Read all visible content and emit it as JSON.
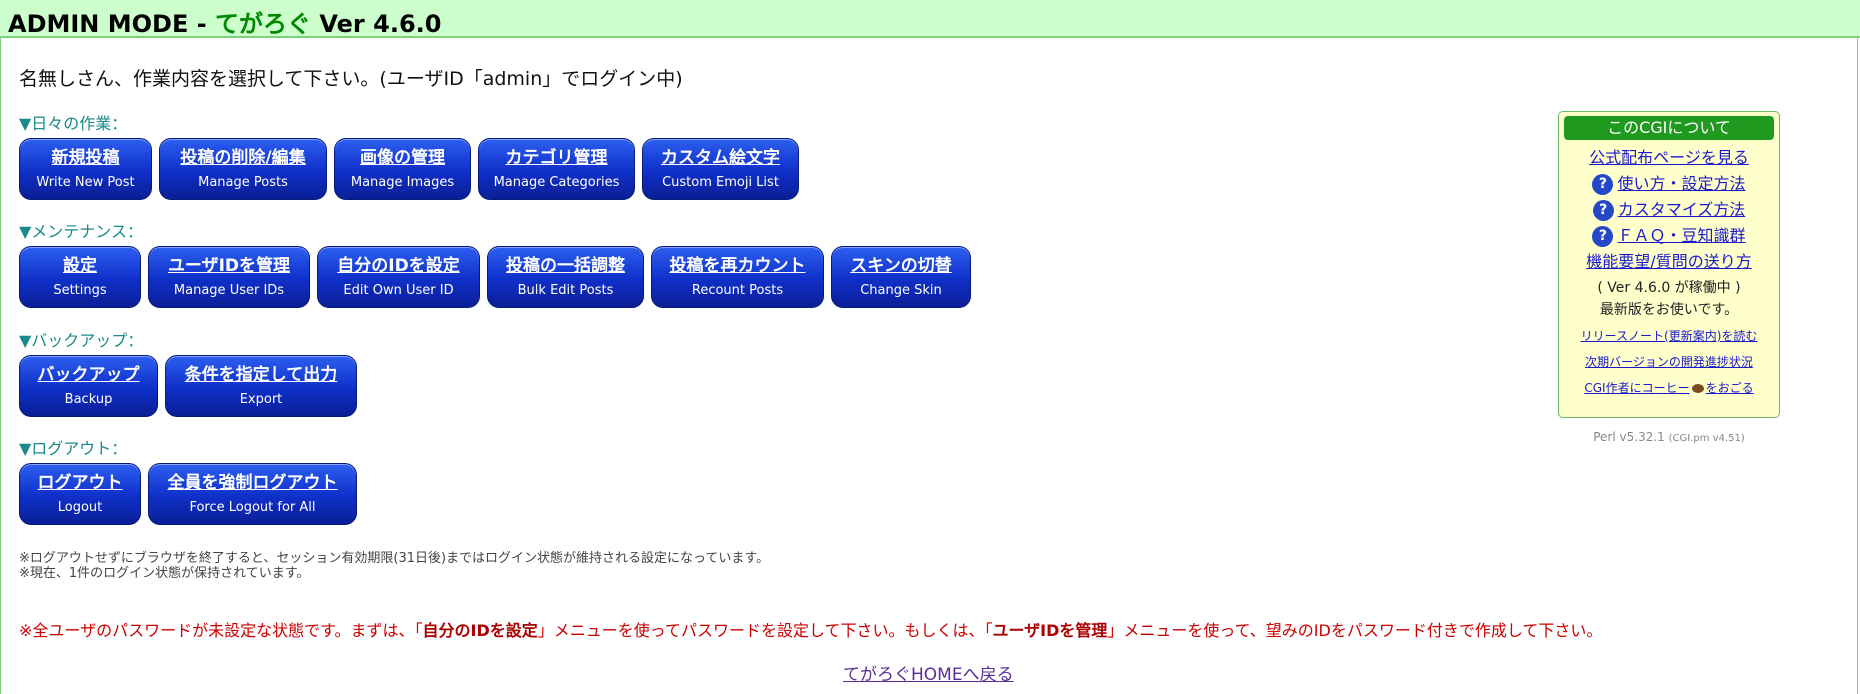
{
  "header": {
    "mode": "ADMIN MODE -",
    "app_name": "てがろぐ",
    "version": "Ver 4.6.0"
  },
  "welcome": "名無しさん、作業内容を選択して下さい。(ユーザID「admin」でログイン中)",
  "sections": [
    {
      "label": "▼日々の作業：",
      "buttons": [
        {
          "jp": "新規投稿",
          "en": "Write New Post"
        },
        {
          "jp": "投稿の削除/編集",
          "en": "Manage Posts"
        },
        {
          "jp": "画像の管理",
          "en": "Manage Images"
        },
        {
          "jp": "カテゴリ管理",
          "en": "Manage Categories"
        },
        {
          "jp": "カスタム絵文字",
          "en": "Custom Emoji List"
        }
      ]
    },
    {
      "label": "▼メンテナンス：",
      "buttons": [
        {
          "jp": "設定",
          "en": "Settings"
        },
        {
          "jp": "ユーザIDを管理",
          "en": "Manage User IDs"
        },
        {
          "jp": "自分のIDを設定",
          "en": "Edit Own User ID"
        },
        {
          "jp": "投稿の一括調整",
          "en": "Bulk Edit Posts"
        },
        {
          "jp": "投稿を再カウント",
          "en": "Recount Posts"
        },
        {
          "jp": "スキンの切替",
          "en": "Change Skin"
        }
      ]
    },
    {
      "label": "▼バックアップ：",
      "buttons": [
        {
          "jp": "バックアップ",
          "en": "Backup"
        },
        {
          "jp": "条件を指定して出力",
          "en": "Export"
        }
      ]
    },
    {
      "label": "▼ログアウト：",
      "buttons": [
        {
          "jp": "ログアウト",
          "en": "Logout"
        },
        {
          "jp": "全員を強制ログアウト",
          "en": "Force Logout for All"
        }
      ]
    }
  ],
  "notes": [
    "※ログアウトせずにブラウザを終了すると、セッション有効期限(31日後)まではログイン状態が維持される設定になっています。",
    "※現在、1件のログイン状態が保持されています。"
  ],
  "warning": {
    "part1": "※全ユーザのパスワードが未設定な状態です。まずは、「",
    "bold1": "自分のIDを設定",
    "part2": "」メニューを使ってパスワードを設定して下さい。もしくは、「",
    "bold2": "ユーザIDを管理",
    "part3": "」メニューを使って、望みのIDをパスワード付きで作成して下さい。"
  },
  "home_link": "てがろぐHOMEへ戻る",
  "sidebox": {
    "title": "このCGIについて",
    "official": "公式配布ページを見る",
    "help_icon": "?",
    "help_links": [
      "使い方・設定方法",
      "カスタマイズ方法",
      "ＦＡＱ・豆知識群"
    ],
    "feedback": "機能要望/質問の送り方",
    "status_line1": "( Ver 4.6.0 が稼働中 )",
    "status_line2": "最新版をお使いです。",
    "release_notes": "リリースノート(更新案内)を読む",
    "progress": "次期バージョンの開発進捗状況",
    "coffee_pre": "CGI作者にコーヒー",
    "coffee_post": "をおごる"
  },
  "perl": {
    "main": "Perl v5.32.1",
    "sub": "(CGI.pm v4.51)"
  }
}
